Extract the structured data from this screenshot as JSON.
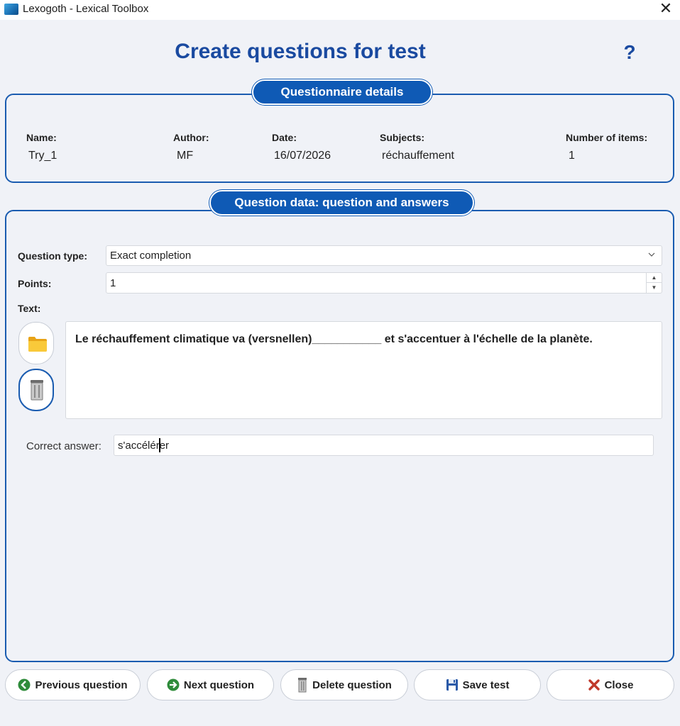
{
  "window": {
    "title": "Lexogoth - Lexical Toolbox",
    "close_glyph": "✕"
  },
  "page": {
    "title": "Create questions for test",
    "help": "?"
  },
  "details": {
    "legend": "Questionnaire details",
    "name_label": "Name:",
    "name_value": "Try_1",
    "author_label": "Author:",
    "author_value": "MF",
    "date_label": "Date:",
    "date_value": "16/07/2026",
    "subjects_label": "Subjects:",
    "subjects_value": "réchauffement",
    "items_label": "Number of items:",
    "items_value": "1"
  },
  "question": {
    "legend": "Question data: question and answers",
    "type_label": "Question type:",
    "type_value": "Exact completion",
    "points_label": "Points:",
    "points_value": "1",
    "text_label": "Text:",
    "text_value": "Le réchauffement climatique va (versnellen)___________ et s'accentuer à l'échelle de la planète.",
    "answer_label": "Correct answer:",
    "answer_value_before_caret": "s'accélér",
    "answer_value_after_caret": "er"
  },
  "buttons": {
    "previous": "Previous question",
    "next": "Next question",
    "delete": "Delete question",
    "save": "Save test",
    "close": "Close"
  },
  "icons": {
    "folder": "folder-icon",
    "trash": "trash-icon",
    "previous": "arrow-left-circle-icon",
    "next": "arrow-right-circle-icon",
    "save": "floppy-disk-icon",
    "close": "red-x-icon"
  },
  "colors": {
    "accent": "#1a4aa0",
    "legend_bg": "#0f5ab5",
    "border": "#1a5cb0",
    "close_red": "#c0392b",
    "go_green": "#2e8b3a"
  }
}
